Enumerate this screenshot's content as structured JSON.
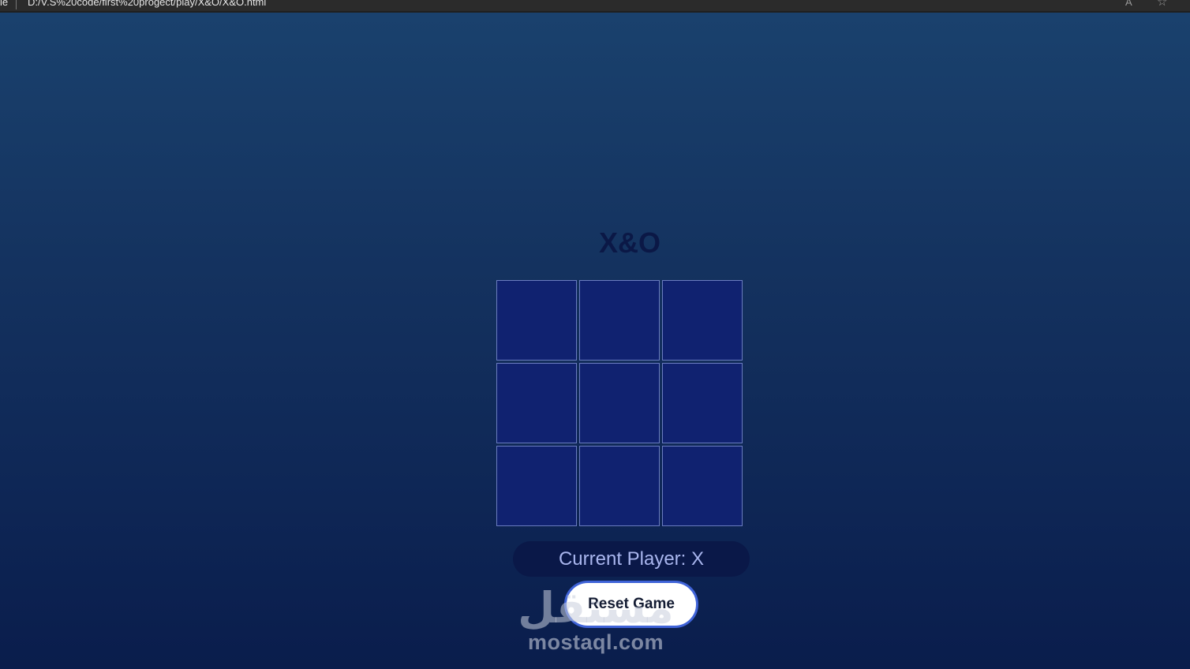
{
  "browser": {
    "tab_tail": "le",
    "url": "D:/V.S%20code/first%20progect/play/X&O/X&O.html"
  },
  "game": {
    "title": "X&O",
    "cells": [
      "",
      "",
      "",
      "",
      "",
      "",
      "",
      "",
      ""
    ],
    "status_text": "Current Player: X",
    "reset_label": "Reset Game"
  },
  "watermark": {
    "arabic": "مستقل",
    "latin": "mostaql.com"
  },
  "colors": {
    "cell_fill": "#102270",
    "cell_border": "#6a7cc0",
    "title": "#0b1846",
    "status_bg": "#0a1848",
    "status_text": "#a9b6ee",
    "button_border": "#3f63d8"
  }
}
